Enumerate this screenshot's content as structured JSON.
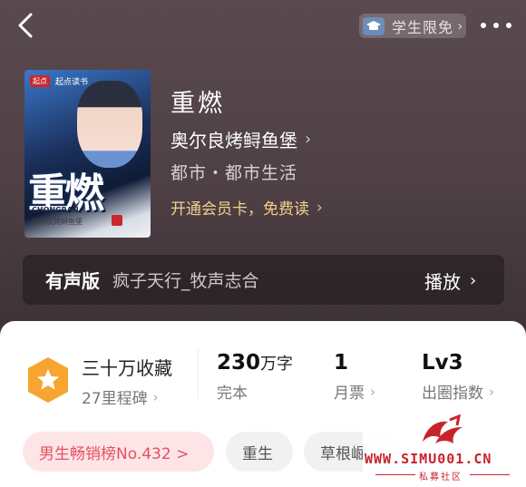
{
  "header": {
    "student_badge": "学生限免"
  },
  "cover": {
    "logo": "起点",
    "logo_text": "起点读书",
    "big_title": "重燃",
    "pinyin": "CHONGRAN",
    "author": "奥尔良烤鲟鱼堡"
  },
  "book": {
    "title": "重燃",
    "author": "奥尔良烤鲟鱼堡",
    "genre": "都市・都市生活",
    "vip_prompt": "开通会员卡，免费读"
  },
  "audio": {
    "label": "有声版",
    "name": "疯子天行_牧声志合",
    "play": "播放"
  },
  "stats": {
    "collect_main": "三十万收藏",
    "collect_sub": "27里程碑",
    "words_num": "230",
    "words_unit": "万字",
    "words_sub": "完本",
    "votes_num": "1",
    "votes_sub": "月票",
    "index_num": "Lv3",
    "index_sub": "出圈指数"
  },
  "tags": {
    "rank": "男生畅销榜No.432 >",
    "tag1": "重生",
    "tag2": "草根崛"
  },
  "watermark": {
    "site": "WWW.SIMU001.CN",
    "sub": "私募社区"
  },
  "colors": {
    "accent_red": "#e6505f",
    "vip_gold": "#f4d08c",
    "medal_orange": "#f7a531"
  },
  "icons": {
    "back": "chevron-left-icon",
    "cap": "graduation-cap-icon",
    "more": "more-dots-icon",
    "medal": "star-medal-icon"
  }
}
